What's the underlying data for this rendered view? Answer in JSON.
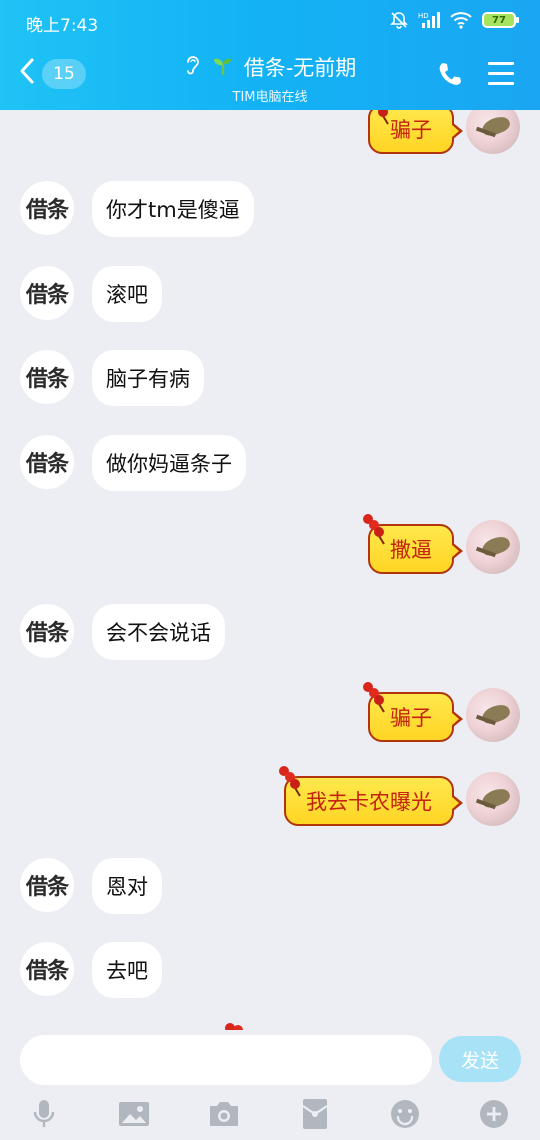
{
  "status_bar": {
    "time": "晚上7:43",
    "battery": "77"
  },
  "nav": {
    "unread_count": "15",
    "title": "借条-无前期",
    "subtitle": "TIM电脑在线"
  },
  "messages": [
    {
      "side": "out",
      "text": "骗子"
    },
    {
      "side": "in",
      "avatar": "借条",
      "text": "你才tm是傻逼"
    },
    {
      "side": "in",
      "avatar": "借条",
      "text": "滚吧"
    },
    {
      "side": "in",
      "avatar": "借条",
      "text": "脑子有病"
    },
    {
      "side": "in",
      "avatar": "借条",
      "text": "做你妈逼条子"
    },
    {
      "side": "out",
      "text": "撒逼"
    },
    {
      "side": "in",
      "avatar": "借条",
      "text": "会不会说话"
    },
    {
      "side": "out",
      "text": "骗子"
    },
    {
      "side": "out",
      "text": "我去卡农曝光"
    },
    {
      "side": "in",
      "avatar": "借条",
      "text": "恩对"
    },
    {
      "side": "in",
      "avatar": "借条",
      "text": "去吧"
    }
  ],
  "input": {
    "placeholder": "",
    "send_label": "发送"
  },
  "toolbar": [
    "mic-icon",
    "image-icon",
    "camera-icon",
    "red-packet-icon",
    "emoji-icon",
    "plus-icon"
  ],
  "colors": {
    "header": "#13b3f5",
    "bubble_out": "#ffd524",
    "bubble_out_text": "#c3230f",
    "send": "#a8e2f7"
  }
}
